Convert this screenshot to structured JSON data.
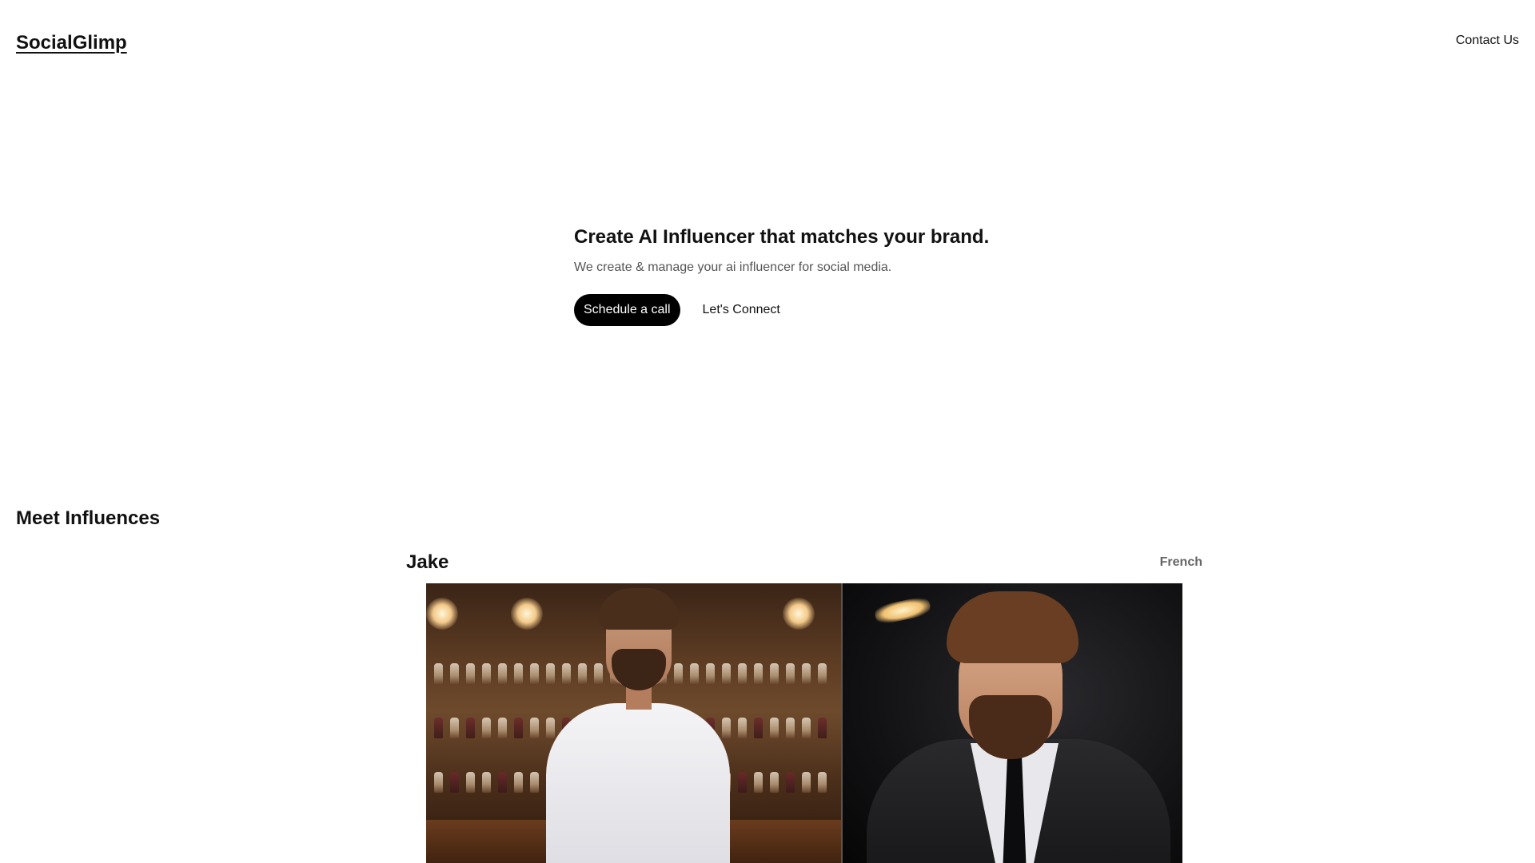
{
  "header": {
    "logo": "SocialGlimp",
    "contact_label": "Contact Us"
  },
  "hero": {
    "title": "Create AI Influencer that matches your brand.",
    "subtitle": "We create & manage your ai influencer for social media.",
    "primary_cta": "Schedule a call",
    "secondary_cta": "Let's Connect"
  },
  "influencers": {
    "section_title": "Meet Influences",
    "items": [
      {
        "name": "Jake",
        "language": "French",
        "photos": [
          "bar-white-shirt-photo",
          "black-suit-photo"
        ]
      }
    ]
  }
}
